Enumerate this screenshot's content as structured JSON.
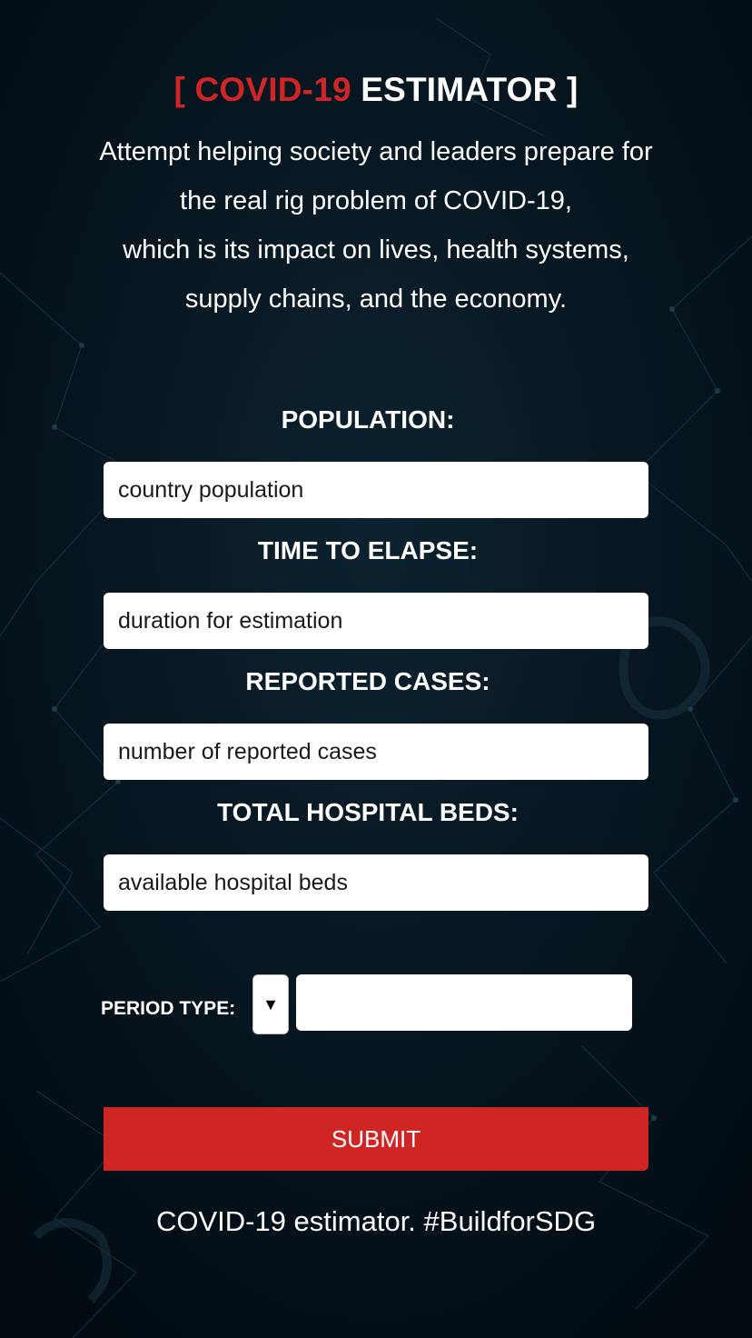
{
  "header": {
    "title_open": "[ ",
    "title_highlight": "COVID-19",
    "title_rest": " ESTIMATOR ]",
    "highlight_color": "#d02525",
    "intro_lines": [
      "Attempt helping society and leaders prepare for",
      "the real rig problem of COVID-19,",
      "which is its impact on lives, health systems,",
      "supply chains, and the economy."
    ]
  },
  "form": {
    "population": {
      "label": "POPULATION:",
      "placeholder": "country population"
    },
    "time_to_elapse": {
      "label": "TIME TO ELAPSE:",
      "placeholder": "duration for estimation"
    },
    "reported_cases": {
      "label": "REPORTED CASES:",
      "placeholder": "number of reported cases"
    },
    "total_hospital_beds": {
      "label": "TOTAL HOSPITAL BEDS:",
      "placeholder": "available hospital beds"
    },
    "period_type": {
      "label": "PERIOD TYPE:",
      "dropdown_glyph": "▼",
      "value": ""
    },
    "submit_label": "SUBMIT",
    "submit_color": "#d02525"
  },
  "footer": {
    "text": "COVID-19 estimator. #BuildforSDG"
  },
  "colors": {
    "background": "#03101a",
    "text": "#ffffff",
    "accent": "#d02525"
  }
}
